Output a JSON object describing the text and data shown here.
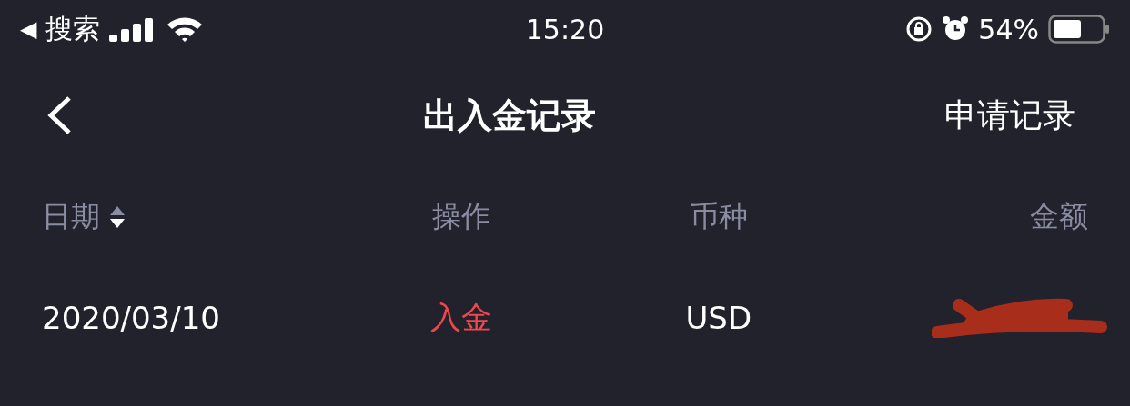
{
  "status_bar": {
    "back_glyph": "◀",
    "back_label": "搜索",
    "time": "15:20",
    "battery": "54%"
  },
  "nav": {
    "title": "出入金记录",
    "action": "申请记录"
  },
  "table": {
    "columns": [
      {
        "label": "日期",
        "sort_descending": true
      },
      {
        "label": "操作"
      },
      {
        "label": "币种"
      },
      {
        "label": "金额"
      }
    ],
    "rows": [
      {
        "date": "2020/03/10",
        "operation": "入金",
        "kind": "deposit",
        "currency": "USD",
        "amount_redacted": true
      }
    ]
  }
}
